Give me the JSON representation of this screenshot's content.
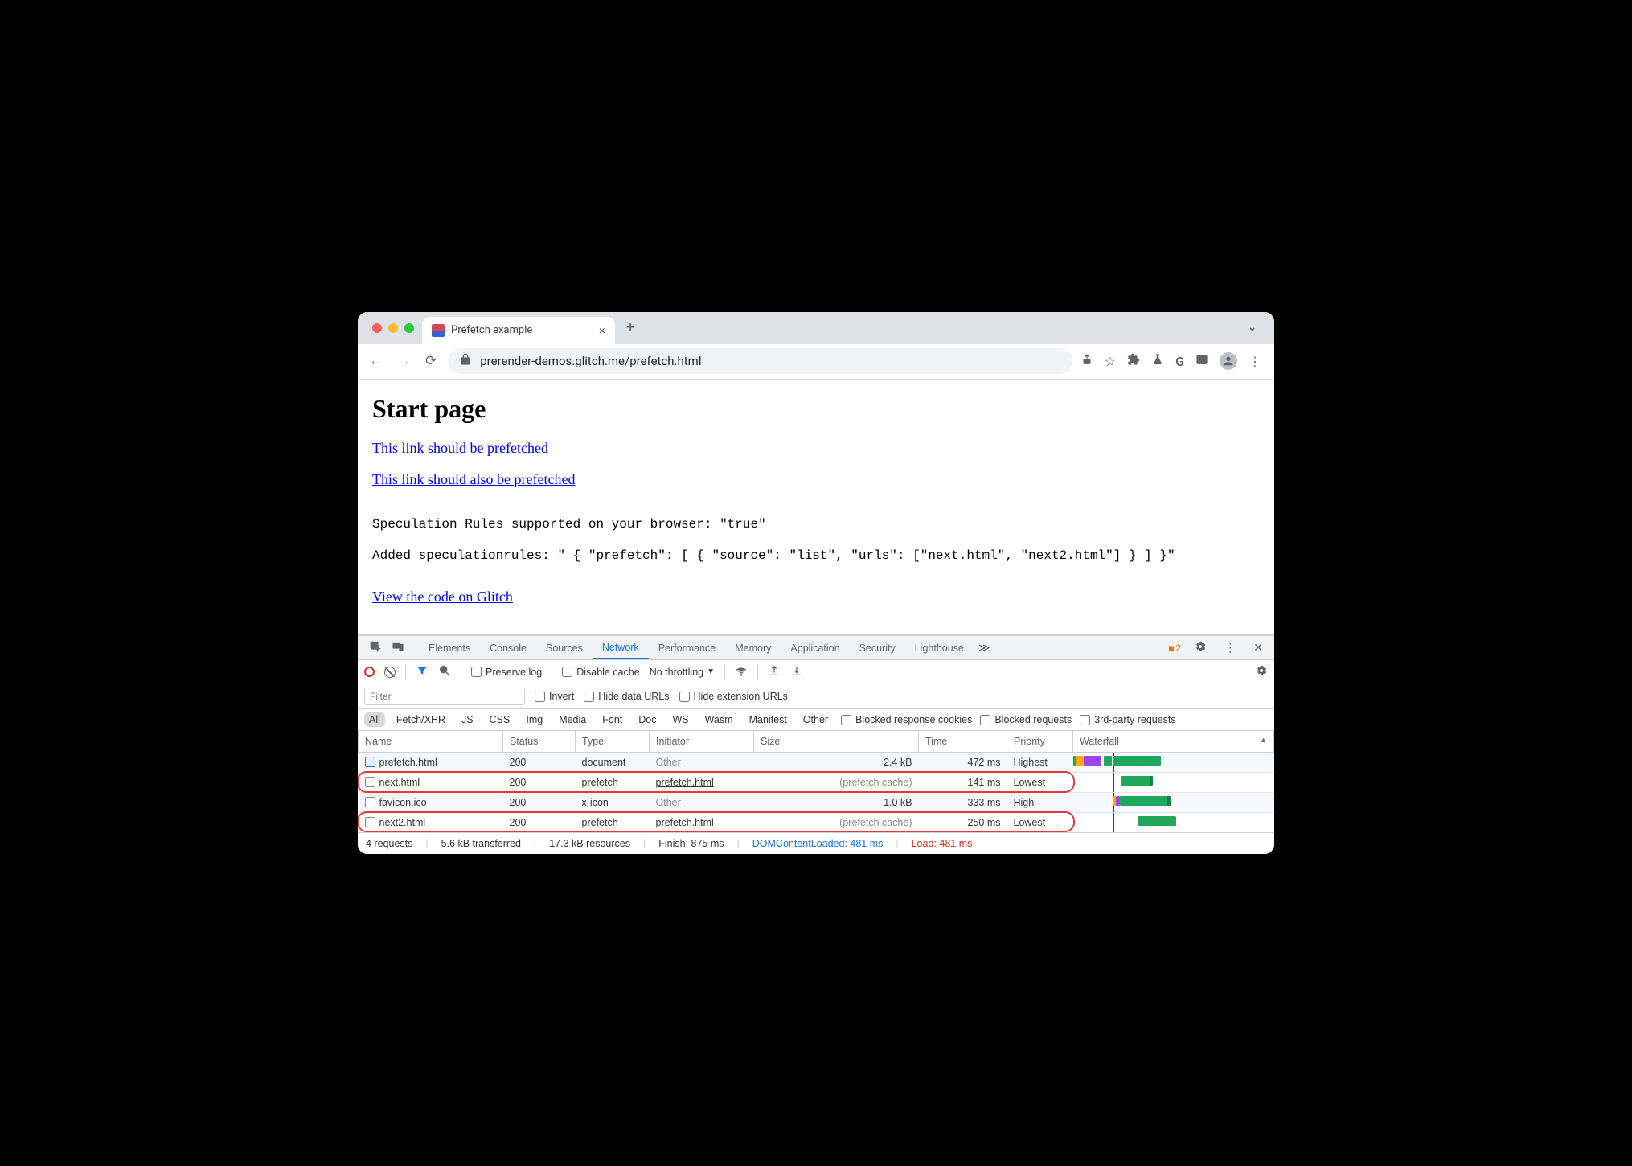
{
  "browser": {
    "tab_title": "Prefetch example",
    "url": "prerender-demos.glitch.me/prefetch.html"
  },
  "page": {
    "heading": "Start page",
    "link1": "This link should be prefetched",
    "link2": "This link should also be prefetched",
    "mono1": "Speculation Rules supported on your browser: \"true\"",
    "mono2": "Added speculationrules: \" { \"prefetch\": [ { \"source\": \"list\", \"urls\": [\"next.html\", \"next2.html\"] } ] }\"",
    "link3": "View the code on Glitch"
  },
  "devtools": {
    "tabs": [
      "Elements",
      "Console",
      "Sources",
      "Network",
      "Performance",
      "Memory",
      "Application",
      "Security",
      "Lighthouse"
    ],
    "active_tab": "Network",
    "issue_count": "2",
    "toolbar": {
      "preserve_log": "Preserve log",
      "disable_cache": "Disable cache",
      "throttling": "No throttling"
    },
    "filter": {
      "placeholder": "Filter",
      "invert": "Invert",
      "hide_data": "Hide data URLs",
      "hide_ext": "Hide extension URLs"
    },
    "types": [
      "All",
      "Fetch/XHR",
      "JS",
      "CSS",
      "Img",
      "Media",
      "Font",
      "Doc",
      "WS",
      "Wasm",
      "Manifest",
      "Other"
    ],
    "type_filters": {
      "blocked_cookies": "Blocked response cookies",
      "blocked_req": "Blocked requests",
      "third_party": "3rd-party requests"
    },
    "columns": [
      "Name",
      "Status",
      "Type",
      "Initiator",
      "Size",
      "Time",
      "Priority",
      "Waterfall"
    ],
    "rows": [
      {
        "name": "prefetch.html",
        "status": "200",
        "type": "document",
        "initiator": "Other",
        "initiator_gray": true,
        "size": "2.4 kB",
        "size_gray": false,
        "time": "472 ms",
        "priority": "Highest",
        "doc": true
      },
      {
        "name": "next.html",
        "status": "200",
        "type": "prefetch",
        "initiator": "prefetch.html",
        "initiator_gray": false,
        "size": "(prefetch cache)",
        "size_gray": true,
        "time": "141 ms",
        "priority": "Lowest",
        "doc": false
      },
      {
        "name": "favicon.ico",
        "status": "200",
        "type": "x-icon",
        "initiator": "Other",
        "initiator_gray": true,
        "size": "1.0 kB",
        "size_gray": false,
        "time": "333 ms",
        "priority": "High",
        "doc": false
      },
      {
        "name": "next2.html",
        "status": "200",
        "type": "prefetch",
        "initiator": "prefetch.html",
        "initiator_gray": false,
        "size": "(prefetch cache)",
        "size_gray": true,
        "time": "250 ms",
        "priority": "Lowest",
        "doc": false
      }
    ],
    "status": {
      "requests": "4 requests",
      "transferred": "5.6 kB transferred",
      "resources": "17.3 kB resources",
      "finish": "Finish: 875 ms",
      "dcl": "DOMContentLoaded: 481 ms",
      "load": "Load: 481 ms"
    }
  }
}
